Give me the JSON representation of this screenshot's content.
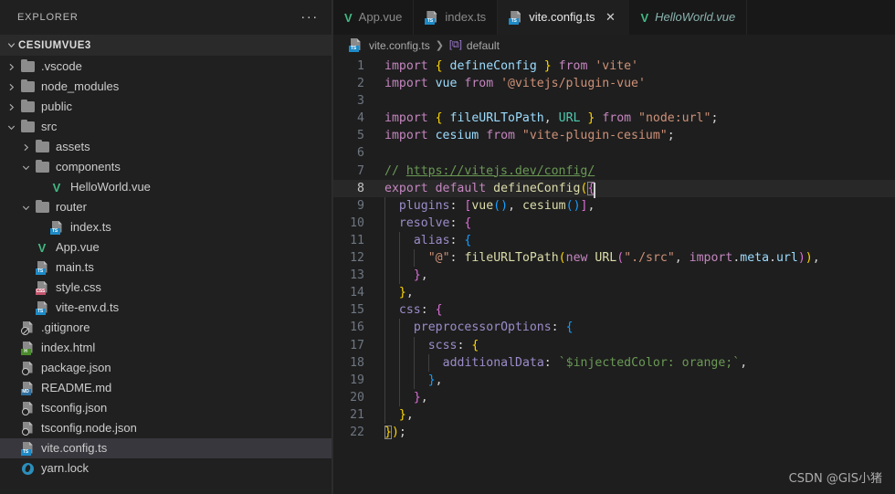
{
  "colors": {
    "editor_bg": "#1e1e1e",
    "sidebar_bg": "#202020",
    "tabbar_bg": "#181818",
    "active_tab_bg": "#1f1f1f",
    "selection_bg": "#37373d",
    "vue_green": "#42b883",
    "ts_blue": "#1d8ac7",
    "css_pink": "#c2566e"
  },
  "sidebar": {
    "title": "EXPLORER",
    "more_actions": "···",
    "root_folder": "CESIUMVUE3",
    "items": [
      {
        "label": ".vscode",
        "kind": "folder",
        "depth": 1,
        "expanded": false,
        "selected": false
      },
      {
        "label": "node_modules",
        "kind": "folder",
        "depth": 1,
        "expanded": false,
        "selected": false
      },
      {
        "label": "public",
        "kind": "folder",
        "depth": 1,
        "expanded": false,
        "selected": false
      },
      {
        "label": "src",
        "kind": "folder",
        "depth": 1,
        "expanded": true,
        "selected": false
      },
      {
        "label": "assets",
        "kind": "folder",
        "depth": 2,
        "expanded": false,
        "selected": false
      },
      {
        "label": "components",
        "kind": "folder",
        "depth": 2,
        "expanded": true,
        "selected": false
      },
      {
        "label": "HelloWorld.vue",
        "kind": "vue",
        "depth": 3,
        "selected": false
      },
      {
        "label": "router",
        "kind": "folder",
        "depth": 2,
        "expanded": true,
        "selected": false
      },
      {
        "label": "index.ts",
        "kind": "ts",
        "depth": 3,
        "selected": false
      },
      {
        "label": "App.vue",
        "kind": "vue",
        "depth": 2,
        "selected": false
      },
      {
        "label": "main.ts",
        "kind": "ts",
        "depth": 2,
        "selected": false
      },
      {
        "label": "style.css",
        "kind": "css",
        "depth": 2,
        "selected": false
      },
      {
        "label": "vite-env.d.ts",
        "kind": "ts",
        "depth": 2,
        "selected": false
      },
      {
        "label": ".gitignore",
        "kind": "git",
        "depth": 1,
        "selected": false
      },
      {
        "label": "index.html",
        "kind": "html",
        "depth": 1,
        "selected": false
      },
      {
        "label": "package.json",
        "kind": "json",
        "depth": 1,
        "selected": false
      },
      {
        "label": "README.md",
        "kind": "md",
        "depth": 1,
        "selected": false
      },
      {
        "label": "tsconfig.json",
        "kind": "json",
        "depth": 1,
        "selected": false
      },
      {
        "label": "tsconfig.node.json",
        "kind": "json",
        "depth": 1,
        "selected": false
      },
      {
        "label": "vite.config.ts",
        "kind": "ts",
        "depth": 1,
        "selected": true
      },
      {
        "label": "yarn.lock",
        "kind": "yarn",
        "depth": 1,
        "selected": false
      }
    ]
  },
  "tabs": [
    {
      "label": "App.vue",
      "icon": "vue-file-icon",
      "active": false,
      "preview": false,
      "closable": false
    },
    {
      "label": "index.ts",
      "icon": "ts-file-icon",
      "active": false,
      "preview": false,
      "closable": false
    },
    {
      "label": "vite.config.ts",
      "icon": "ts-file-icon",
      "active": true,
      "preview": false,
      "closable": true,
      "close_glyph": "✕"
    },
    {
      "label": "HelloWorld.vue",
      "icon": "vue-file-icon",
      "active": false,
      "preview": true,
      "closable": false
    }
  ],
  "breadcrumb": {
    "file_icon": "ts-file-icon",
    "file": "vite.config.ts",
    "separator": "❯",
    "symbol_glyph": "[⧉]",
    "symbol": "default"
  },
  "editor": {
    "language": "typescript",
    "current_line": 8,
    "total_lines": 22,
    "lines": [
      {
        "n": 1,
        "text": "import { defineConfig } from 'vite'"
      },
      {
        "n": 2,
        "text": "import vue from '@vitejs/plugin-vue'"
      },
      {
        "n": 3,
        "text": ""
      },
      {
        "n": 4,
        "text": "import { fileURLToPath, URL } from \"node:url\";"
      },
      {
        "n": 5,
        "text": "import cesium from \"vite-plugin-cesium\";"
      },
      {
        "n": 6,
        "text": ""
      },
      {
        "n": 7,
        "text": "// https://vitejs.dev/config/"
      },
      {
        "n": 8,
        "text": "export default defineConfig({"
      },
      {
        "n": 9,
        "text": "  plugins: [vue(), cesium()],"
      },
      {
        "n": 10,
        "text": "  resolve: {"
      },
      {
        "n": 11,
        "text": "    alias: {"
      },
      {
        "n": 12,
        "text": "      \"@\": fileURLToPath(new URL(\"./src\", import.meta.url)),"
      },
      {
        "n": 13,
        "text": "    },"
      },
      {
        "n": 14,
        "text": "  },"
      },
      {
        "n": 15,
        "text": "  css: {"
      },
      {
        "n": 16,
        "text": "    preprocessorOptions: {"
      },
      {
        "n": 17,
        "text": "      scss: {"
      },
      {
        "n": 18,
        "text": "        additionalData: `$injectedColor: orange;`,"
      },
      {
        "n": 19,
        "text": "      },"
      },
      {
        "n": 20,
        "text": "    },"
      },
      {
        "n": 21,
        "text": "  },"
      },
      {
        "n": 22,
        "text": "});"
      }
    ]
  },
  "watermark": "CSDN @GIS小猪"
}
